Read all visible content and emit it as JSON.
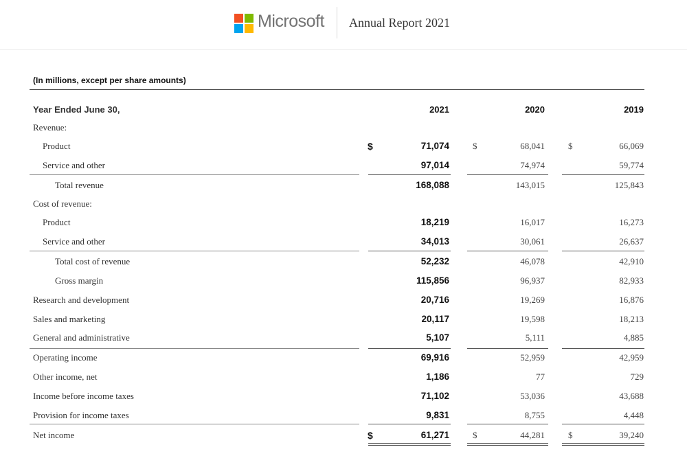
{
  "header": {
    "brand": "Microsoft",
    "report_title": "Annual Report 2021",
    "logo_colors": [
      "#f25022",
      "#7fba00",
      "#00a4ef",
      "#ffb900"
    ]
  },
  "table": {
    "caption": "(In millions, except per share amounts)",
    "period_label": "Year Ended June 30,",
    "years": [
      "2021",
      "2020",
      "2019"
    ],
    "currency_symbol": "$",
    "rows": [
      {
        "label": "Revenue:",
        "values": [
          "",
          "",
          ""
        ]
      },
      {
        "label": "Product",
        "values": [
          "71,074",
          "68,041",
          "66,069"
        ]
      },
      {
        "label": "Service and other",
        "values": [
          "97,014",
          "74,974",
          "59,774"
        ]
      },
      {
        "label": "Total revenue",
        "values": [
          "168,088",
          "143,015",
          "125,843"
        ]
      },
      {
        "label": "Cost of revenue:",
        "values": [
          "",
          "",
          ""
        ]
      },
      {
        "label": "Product",
        "values": [
          "18,219",
          "16,017",
          "16,273"
        ]
      },
      {
        "label": "Service and other",
        "values": [
          "34,013",
          "30,061",
          "26,637"
        ]
      },
      {
        "label": "Total cost of revenue",
        "values": [
          "52,232",
          "46,078",
          "42,910"
        ]
      },
      {
        "label": "Gross margin",
        "values": [
          "115,856",
          "96,937",
          "82,933"
        ]
      },
      {
        "label": "Research and development",
        "values": [
          "20,716",
          "19,269",
          "16,876"
        ]
      },
      {
        "label": "Sales and marketing",
        "values": [
          "20,117",
          "19,598",
          "18,213"
        ]
      },
      {
        "label": "General and administrative",
        "values": [
          "5,107",
          "5,111",
          "4,885"
        ]
      },
      {
        "label": "Operating income",
        "values": [
          "69,916",
          "52,959",
          "42,959"
        ]
      },
      {
        "label": "Other income, net",
        "values": [
          "1,186",
          "77",
          "729"
        ]
      },
      {
        "label": "Income before income taxes",
        "values": [
          "71,102",
          "53,036",
          "43,688"
        ]
      },
      {
        "label": "Provision for income taxes",
        "values": [
          "9,831",
          "8,755",
          "4,448"
        ]
      },
      {
        "label": "Net income",
        "values": [
          "61,271",
          "44,281",
          "39,240"
        ]
      }
    ]
  }
}
